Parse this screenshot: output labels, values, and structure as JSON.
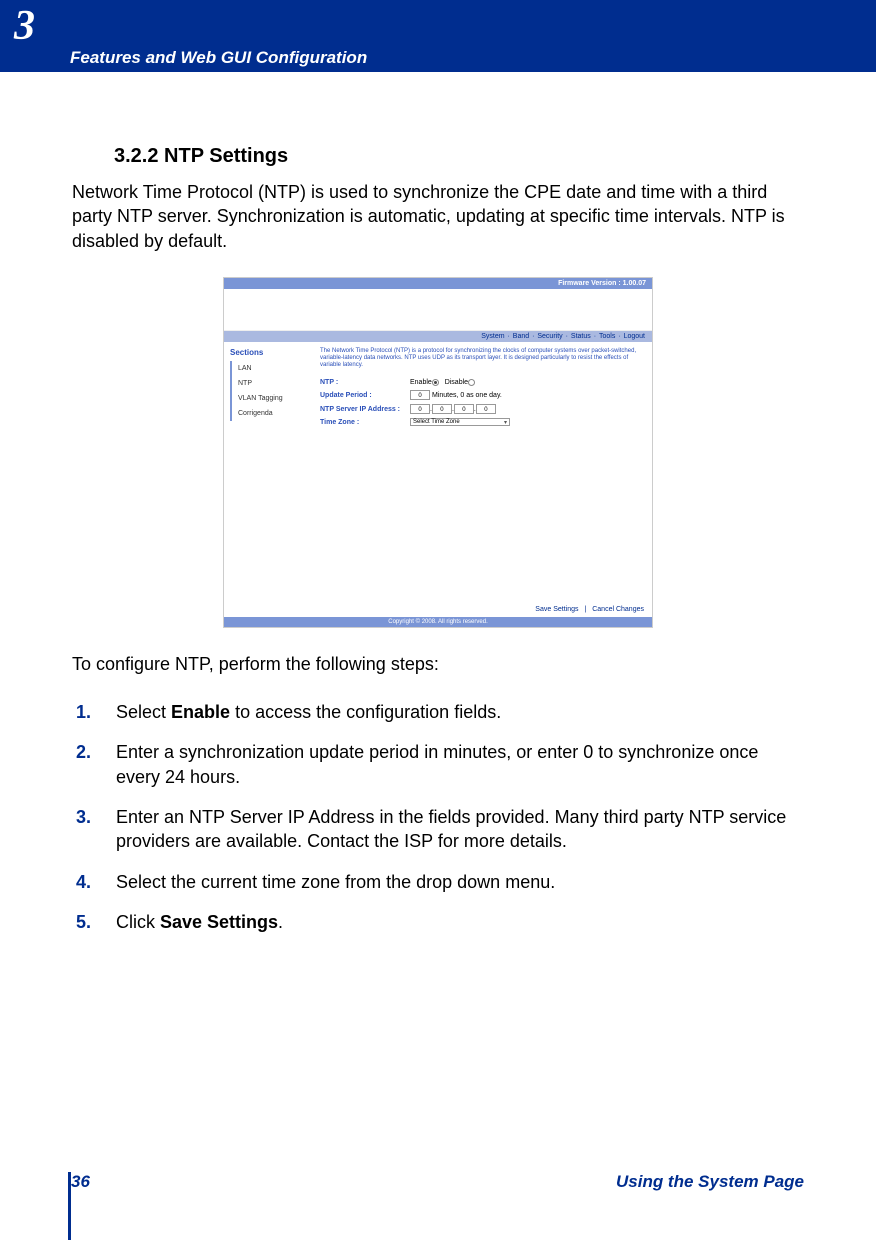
{
  "header": {
    "chapter_number": "3",
    "title": "Features and Web GUI Configuration"
  },
  "section": {
    "number": "3.2.2",
    "title": "NTP Settings",
    "intro": "Network Time Protocol (NTP) is used to synchronize the CPE date and time with a third party NTP server. Synchronization is automatic, updating at specific time intervals. NTP is disabled by default.",
    "lead_in": "To configure NTP, perform the following steps:"
  },
  "screenshot": {
    "firmware": "Firmware Version : 1.00.07",
    "nav": [
      "System",
      "Band",
      "Security",
      "Status",
      "Tools",
      "Logout"
    ],
    "sections_label": "Sections",
    "side_items": [
      "LAN",
      "NTP",
      "VLAN Tagging",
      "Corrigenda"
    ],
    "intro": "The Network Time Protocol (NTP) is a protocol for synchronizing the clocks of computer systems over packet-switched, variable-latency data networks. NTP uses UDP as its transport layer. It is designed particularly to resist the effects of variable latency.",
    "fields": {
      "ntp_label": "NTP :",
      "enable": "Enable",
      "disable": "Disable",
      "update_label": "Update Period :",
      "update_value": "0",
      "update_suffix": "Minutes, 0 as one day.",
      "ip_label": "NTP Server IP Address :",
      "ip_parts": [
        "0",
        "0",
        "0",
        "0"
      ],
      "tz_label": "Time Zone :",
      "tz_value": "Select Time Zone"
    },
    "footer": {
      "save": "Save Settings",
      "cancel": "Cancel Changes"
    },
    "copyright": "Copyright © 2008.  All rights reserved."
  },
  "steps": [
    {
      "n": "1.",
      "before": "Select ",
      "bold": "Enable",
      "after": " to access the configuration fields."
    },
    {
      "n": "2.",
      "before": "Enter a synchronization update period in minutes, or enter 0 to synchronize once every 24 hours.",
      "bold": "",
      "after": ""
    },
    {
      "n": "3.",
      "before": "Enter an NTP Server IP Address in the fields provided. Many third party NTP service providers are available. Contact the ISP for more details.",
      "bold": "",
      "after": ""
    },
    {
      "n": "4.",
      "before": "Select the current time zone from the drop down menu.",
      "bold": "",
      "after": ""
    },
    {
      "n": "5.",
      "before": "Click ",
      "bold": "Save Settings",
      "after": "."
    }
  ],
  "footer": {
    "page_number": "36",
    "title": "Using the System Page"
  }
}
